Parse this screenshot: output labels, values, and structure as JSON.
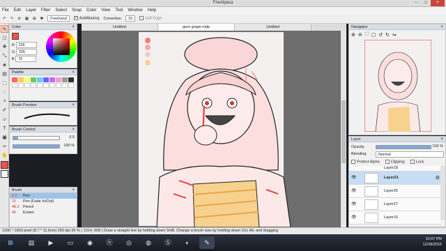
{
  "window": {
    "title": "FireAlpaca"
  },
  "menu": [
    "File",
    "Edit",
    "Layer",
    "Filter",
    "Select",
    "Snap",
    "Color",
    "View",
    "Tool",
    "Window",
    "Help"
  ],
  "tool_options": {
    "mode": "Freehand",
    "antialiasing": "AntiAliasing",
    "correction_label": "Correction",
    "correction_value": "15",
    "soft_edge": "Soft Edge"
  },
  "tabs": [
    {
      "label": "Untitled"
    },
    {
      "label": "guro grape.mdp"
    },
    {
      "label": "Untitled"
    }
  ],
  "color_panel": {
    "title": "Color",
    "r_label": "R",
    "r_value": "255",
    "g_label": "G",
    "g_value": "205",
    "b_label": "B",
    "b_value": "76"
  },
  "palette_panel": {
    "title": "Palette"
  },
  "brush_preview_panel": {
    "title": "Brush Preview"
  },
  "brush_control_panel": {
    "title": "Brush Control",
    "size_value": "6.5",
    "opacity_value": "100 %"
  },
  "brush_panel": {
    "title": "Brush",
    "items": [
      {
        "size": "6.5",
        "name": "Pen"
      },
      {
        "size": "15",
        "name": "Pen (Fade In/Out)"
      },
      {
        "size": "48.2",
        "name": "Pencil"
      },
      {
        "size": "46",
        "name": "Eraser"
      }
    ]
  },
  "navigator_panel": {
    "title": "Navigator"
  },
  "layer_panel": {
    "title": "Layer",
    "opacity_label": "Opacity",
    "opacity_value": "100 %",
    "blending_label": "Blending",
    "blending_value": "Normal",
    "protect_alpha": "Protect Alpha",
    "clipping": "Clipping",
    "lock": "Lock",
    "layers": [
      {
        "name": "Layer18"
      },
      {
        "name": "Layer21"
      },
      {
        "name": "Layer26"
      },
      {
        "name": "Layer27"
      },
      {
        "name": "Layer16"
      }
    ]
  },
  "status_bar": {
    "text": "1200 * 1600 pixel   (8.7 * 11.6cm)  250 dpi   36 %   ( 1314, 608 )   Draw a straight line by holding down Shift, Change a brush size by holding down Ctrl, Alt, and dragging"
  },
  "taskbar": {
    "time": "10:07 PM",
    "date": "12/28/2015"
  },
  "colors": {
    "accent": "#ff4d4d",
    "selection": "#c7ddf3",
    "taskbar": "#1c2029"
  }
}
